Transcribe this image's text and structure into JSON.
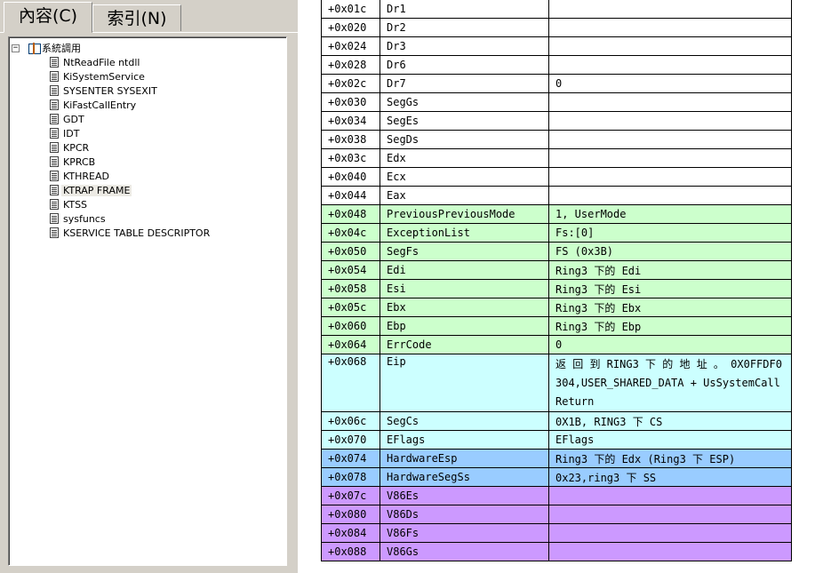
{
  "tabs": {
    "contents": "內容(C)",
    "index": "索引(N)"
  },
  "tree": {
    "root": {
      "expander": "−",
      "label": "系統調用"
    },
    "items": [
      "NtReadFile ntdll",
      "KiSystemService",
      "SYSENTER SYSEXIT",
      "KiFastCallEntry",
      "GDT",
      "IDT",
      "KPCR",
      "KPRCB",
      "KTHREAD",
      "KTRAP FRAME",
      "KTSS",
      "sysfuncs",
      "KSERVICE TABLE DESCRIPTOR"
    ],
    "selected_index": 9
  },
  "colors": {
    "white": "#ffffff",
    "green": "#ccffcc",
    "cyan": "#ccffff",
    "blue": "#99ccff",
    "purple": "#cc99ff"
  },
  "table": {
    "rows": [
      {
        "offset": "+0x01c",
        "name": "Dr1",
        "value": "",
        "color": "white"
      },
      {
        "offset": "+0x020",
        "name": "Dr2",
        "value": "",
        "color": "white"
      },
      {
        "offset": "+0x024",
        "name": "Dr3",
        "value": "",
        "color": "white"
      },
      {
        "offset": "+0x028",
        "name": "Dr6",
        "value": "",
        "color": "white"
      },
      {
        "offset": "+0x02c",
        "name": "Dr7",
        "value": "0",
        "color": "white"
      },
      {
        "offset": "+0x030",
        "name": "SegGs",
        "value": "",
        "color": "white"
      },
      {
        "offset": "+0x034",
        "name": "SegEs",
        "value": "",
        "color": "white"
      },
      {
        "offset": "+0x038",
        "name": "SegDs",
        "value": "",
        "color": "white"
      },
      {
        "offset": "+0x03c",
        "name": "Edx",
        "value": "",
        "color": "white"
      },
      {
        "offset": "+0x040",
        "name": "Ecx",
        "value": "",
        "color": "white"
      },
      {
        "offset": "+0x044",
        "name": "Eax",
        "value": "",
        "color": "white"
      },
      {
        "offset": "+0x048",
        "name": "PreviousPreviousMode",
        "value": "1, UserMode",
        "color": "green"
      },
      {
        "offset": "+0x04c",
        "name": "ExceptionList",
        "value": "Fs:[0]",
        "color": "green"
      },
      {
        "offset": "+0x050",
        "name": "SegFs",
        "value": "FS (0x3B)",
        "color": "green"
      },
      {
        "offset": "+0x054",
        "name": "Edi",
        "value": "Ring3 下的 Edi",
        "color": "green"
      },
      {
        "offset": "+0x058",
        "name": "Esi",
        "value": "Ring3 下的 Esi",
        "color": "green"
      },
      {
        "offset": "+0x05c",
        "name": "Ebx",
        "value": "Ring3 下的 Ebx",
        "color": "green"
      },
      {
        "offset": "+0x060",
        "name": "Ebp",
        "value": "Ring3 下的 Ebp",
        "color": "green"
      },
      {
        "offset": "+0x064",
        "name": "ErrCode",
        "value": "0",
        "color": "green"
      },
      {
        "offset": "+0x068",
        "name": "Eip",
        "value": "返 回 到  RING3  下 的 地 址 。 0X0FFDF0304,USER_SHARED_DATA  + UsSystemCallReturn",
        "color": "cyan",
        "wrap": true
      },
      {
        "offset": "+0x06c",
        "name": "SegCs",
        "value": "0X1B, RING3 下 CS",
        "color": "cyan"
      },
      {
        "offset": "+0x070",
        "name": "EFlags",
        "value": "EFlags",
        "color": "cyan"
      },
      {
        "offset": "+0x074",
        "name": "HardwareEsp",
        "value": "Ring3 下的 Edx (Ring3 下 ESP)",
        "color": "blue"
      },
      {
        "offset": "+0x078",
        "name": "HardwareSegSs",
        "value": "0x23,ring3 下 SS",
        "color": "blue"
      },
      {
        "offset": "+0x07c",
        "name": "V86Es",
        "value": "",
        "color": "purple"
      },
      {
        "offset": "+0x080",
        "name": "V86Ds",
        "value": "",
        "color": "purple"
      },
      {
        "offset": "+0x084",
        "name": "V86Fs",
        "value": "",
        "color": "purple"
      },
      {
        "offset": "+0x088",
        "name": "V86Gs",
        "value": "",
        "color": "purple"
      }
    ]
  }
}
